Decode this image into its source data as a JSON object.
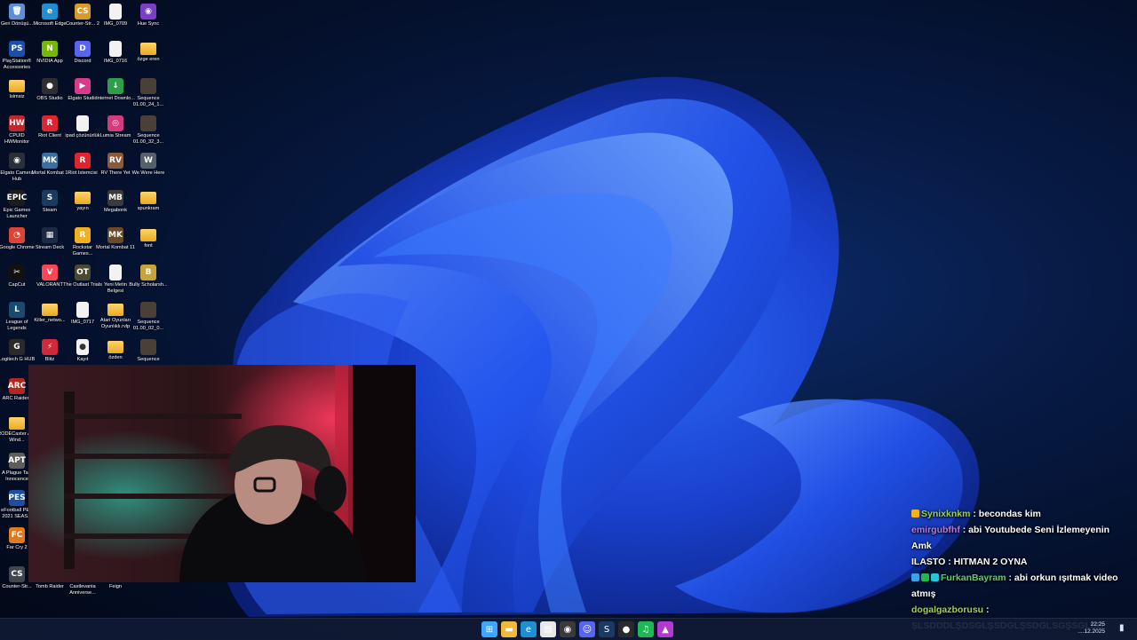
{
  "desktop": {
    "icons": [
      {
        "label": "Geri Dönüşü...",
        "glyph": "🗑",
        "color": "#5c8fd6",
        "type": "app",
        "icon_name": "recycle-bin-icon"
      },
      {
        "label": "Microsoft Edge",
        "glyph": "e",
        "color": "#1f8fd4",
        "type": "app",
        "icon_name": "edge-icon"
      },
      {
        "label": "Counter-Str... 2",
        "glyph": "CS",
        "color": "#d89a2a",
        "type": "app",
        "icon_name": "counter-strike-icon"
      },
      {
        "label": "IMG_0709",
        "glyph": "",
        "color": "#f2f2f2",
        "type": "file",
        "icon_name": "image-file-icon"
      },
      {
        "label": "Hue Sync",
        "glyph": "◉",
        "color": "#7a3fc2",
        "type": "app",
        "icon_name": "hue-sync-icon"
      },
      {
        "label": "PlayStation® Accessories",
        "glyph": "PS",
        "color": "#1b4fa8",
        "type": "app",
        "icon_name": "playstation-icon"
      },
      {
        "label": "NVIDIA App",
        "glyph": "N",
        "color": "#76b900",
        "type": "app",
        "icon_name": "nvidia-icon"
      },
      {
        "label": "Discord",
        "glyph": "D",
        "color": "#5865f2",
        "type": "app",
        "icon_name": "discord-icon"
      },
      {
        "label": "IMG_0716",
        "glyph": "",
        "color": "#f2f2f2",
        "type": "file",
        "icon_name": "image-file-icon"
      },
      {
        "label": "özge eren",
        "glyph": "",
        "color": "#f0b93a",
        "type": "folder",
        "icon_name": "folder-icon"
      },
      {
        "label": "İsimsiz",
        "glyph": "",
        "color": "#f0b93a",
        "type": "folder",
        "icon_name": "folder-icon"
      },
      {
        "label": "OBS Studio",
        "glyph": "●",
        "color": "#302e31",
        "type": "app",
        "icon_name": "obs-icon"
      },
      {
        "label": "Elgato Studio",
        "glyph": "▶",
        "color": "#d93b8c",
        "type": "app",
        "icon_name": "elgato-studio-icon"
      },
      {
        "label": "Internet Downlo...",
        "glyph": "↓",
        "color": "#2f9e4b",
        "type": "app",
        "icon_name": "internet-download-icon"
      },
      {
        "label": "Sequence 01.00_24_1...",
        "glyph": "",
        "color": "#4b4038",
        "type": "app",
        "icon_name": "video-thumb-icon"
      },
      {
        "label": "CPUID HWMonitor",
        "glyph": "HW",
        "color": "#c0282d",
        "type": "app",
        "icon_name": "hwmonitor-icon"
      },
      {
        "label": "Riot Client",
        "glyph": "R",
        "color": "#e0242f",
        "type": "app",
        "icon_name": "riot-client-icon"
      },
      {
        "label": "ipad çözünürlük",
        "glyph": "",
        "color": "#f2f2f2",
        "type": "file",
        "icon_name": "document-icon"
      },
      {
        "label": "Lumia Stream",
        "glyph": "◎",
        "color": "#d53b7c",
        "type": "app",
        "icon_name": "lumia-stream-icon"
      },
      {
        "label": "Sequence 01.00_32_3...",
        "glyph": "",
        "color": "#4b4038",
        "type": "app",
        "icon_name": "video-thumb-icon"
      },
      {
        "label": "Elgato Camera Hub",
        "glyph": "◉",
        "color": "#2b2f3a",
        "type": "app",
        "icon_name": "camera-hub-icon"
      },
      {
        "label": "Mortal Kombat 1",
        "glyph": "MK",
        "color": "#3a6fa3",
        "type": "app",
        "icon_name": "mortal-kombat-icon"
      },
      {
        "label": "Riot İstemcisi",
        "glyph": "R",
        "color": "#e0242f",
        "type": "app",
        "icon_name": "riot-client-icon"
      },
      {
        "label": "RV There Yet",
        "glyph": "RV",
        "color": "#8a5a3a",
        "type": "app",
        "icon_name": "game-icon"
      },
      {
        "label": "We Were Here",
        "glyph": "W",
        "color": "#55606a",
        "type": "app",
        "icon_name": "game-icon"
      },
      {
        "label": "Epic Games Launcher",
        "glyph": "EPIC",
        "color": "#1c1c1c",
        "type": "app",
        "icon_name": "epic-games-icon"
      },
      {
        "label": "Steam",
        "glyph": "S",
        "color": "#1b3a5f",
        "type": "app",
        "icon_name": "steam-icon"
      },
      {
        "label": "yayın",
        "glyph": "",
        "color": "#f0b93a",
        "type": "folder",
        "icon_name": "folder-icon"
      },
      {
        "label": "Megabonk",
        "glyph": "MB",
        "color": "#3b3b3b",
        "type": "app",
        "icon_name": "game-icon"
      },
      {
        "label": "spunkram",
        "glyph": "",
        "color": "#f0b93a",
        "type": "folder",
        "icon_name": "folder-icon"
      },
      {
        "label": "Google Chrome",
        "glyph": "◔",
        "color": "#db4437",
        "type": "app",
        "icon_name": "chrome-icon"
      },
      {
        "label": "Stream Deck",
        "glyph": "▦",
        "color": "#1e2a44",
        "type": "app",
        "icon_name": "stream-deck-icon"
      },
      {
        "label": "Rockstar Games...",
        "glyph": "R",
        "color": "#f2b01e",
        "type": "app",
        "icon_name": "rockstar-icon"
      },
      {
        "label": "Mortal Kombat 11",
        "glyph": "MK",
        "color": "#6b4a2a",
        "type": "app",
        "icon_name": "mortal-kombat-icon"
      },
      {
        "label": "font",
        "glyph": "",
        "color": "#f0b93a",
        "type": "folder",
        "icon_name": "folder-icon"
      },
      {
        "label": "CapCut",
        "glyph": "✂",
        "color": "#111111",
        "type": "app",
        "icon_name": "capcut-icon"
      },
      {
        "label": "VALORANT",
        "glyph": "V",
        "color": "#fd4556",
        "type": "app",
        "icon_name": "valorant-icon"
      },
      {
        "label": "The Outlast Trials",
        "glyph": "OT",
        "color": "#4a4a32",
        "type": "app",
        "icon_name": "game-icon"
      },
      {
        "label": "Yeni Metin Belgesi",
        "glyph": "",
        "color": "#f2f2f2",
        "type": "file",
        "icon_name": "document-icon"
      },
      {
        "label": "Bully Scholarsh...",
        "glyph": "B",
        "color": "#c8a23a",
        "type": "app",
        "icon_name": "game-icon"
      },
      {
        "label": "League of Legends",
        "glyph": "L",
        "color": "#1a4a6e",
        "type": "app",
        "icon_name": "league-icon"
      },
      {
        "label": "Killer_netwo...",
        "glyph": "",
        "color": "#f0b93a",
        "type": "folder",
        "icon_name": "folder-icon"
      },
      {
        "label": "IMG_0717",
        "glyph": "",
        "color": "#f2f2f2",
        "type": "file",
        "icon_name": "image-file-icon"
      },
      {
        "label": "Atari Oyunları Oyunlıklı.rvlp",
        "glyph": "",
        "color": "#f0b93a",
        "type": "folder",
        "icon_name": "folder-icon"
      },
      {
        "label": "Sequence 01.00_02_0...",
        "glyph": "",
        "color": "#4b4038",
        "type": "app",
        "icon_name": "video-thumb-icon"
      },
      {
        "label": "Logitech G HUB",
        "glyph": "G",
        "color": "#2a2a2a",
        "type": "app",
        "icon_name": "logitech-icon"
      },
      {
        "label": "Blitz",
        "glyph": "⚡",
        "color": "#d2283c",
        "type": "app",
        "icon_name": "blitz-icon"
      },
      {
        "label": "Kayıt",
        "glyph": "●",
        "color": "#e8e8e8",
        "type": "file",
        "icon_name": "recording-icon"
      },
      {
        "label": "özden",
        "glyph": "",
        "color": "#f0b93a",
        "type": "folder",
        "icon_name": "folder-icon"
      },
      {
        "label": "Sequence",
        "glyph": "",
        "color": "#4b4038",
        "type": "app",
        "icon_name": "video-thumb-icon"
      },
      {
        "label": "ARC Raiders",
        "glyph": "ARC",
        "color": "#b0281e",
        "type": "app",
        "icon_name": "arc-raiders-icon"
      },
      {
        "label": "RODECaster App Wind...",
        "glyph": "",
        "color": "#f0b93a",
        "type": "folder",
        "icon_name": "folder-icon"
      },
      {
        "label": "A Plague Tale Innocence",
        "glyph": "APT",
        "color": "#5d5d5d",
        "type": "app",
        "icon_name": "game-icon"
      },
      {
        "label": "eFootball PES 2021 SEAS...",
        "glyph": "PES",
        "color": "#1e4fa0",
        "type": "app",
        "icon_name": "efootball-icon"
      },
      {
        "label": "Far Cry 2",
        "glyph": "FC",
        "color": "#e07a1e",
        "type": "app",
        "icon_name": "far-cry-icon"
      },
      {
        "label": "Counter-Str...",
        "glyph": "CS",
        "color": "#41474f",
        "type": "app",
        "icon_name": "counter-strike-icon"
      },
      {
        "label": "Tomb Raider",
        "glyph": "",
        "color": "#2e2a26",
        "type": "app",
        "icon_name": "tomb-raider-icon"
      },
      {
        "label": "Castlevania Anniverse...",
        "glyph": "",
        "color": "#2e2a26",
        "type": "app",
        "icon_name": "castlevania-icon"
      },
      {
        "label": "Feign",
        "glyph": "",
        "color": "#2e2a26",
        "type": "app",
        "icon_name": "feign-icon"
      }
    ]
  },
  "chat": {
    "messages": [
      {
        "user": "Synixknkm",
        "text": "becondas kim",
        "color": "#9ad34a",
        "badges": [
          "#f5b21a"
        ]
      },
      {
        "user": "emirgubfhf",
        "text": "abi Youtubede Seni İzlemeyenin Amk",
        "color": "#b877e3",
        "badges": []
      },
      {
        "user": "ILASTO",
        "text": "HITMAN 2 OYNA",
        "color": "#ffffff",
        "badges": []
      },
      {
        "user": "FurkanBayram",
        "text": "abi orkun ışıtmak video atmış",
        "color": "#56d26b",
        "badges": [
          "#3aa0e8",
          "#23b84f",
          "#26c6da"
        ]
      },
      {
        "user": "dogalgazborusu",
        "text": "ŞLSDDDLŞDSGLŞSDGLŞSDGLSGŞSGLŞD",
        "color": "#9ad34a",
        "badges": []
      }
    ]
  },
  "taskbar": {
    "apps": [
      {
        "name": "start-button",
        "glyph": "⊞",
        "color": "#3ea6ff"
      },
      {
        "name": "file-explorer-icon",
        "glyph": "▬",
        "color": "#f0b93a"
      },
      {
        "name": "edge-taskbar-icon",
        "glyph": "e",
        "color": "#1f8fd4"
      },
      {
        "name": "notepad-taskbar-icon",
        "glyph": "▤",
        "color": "#e8e8e8"
      },
      {
        "name": "obs-taskbar-icon",
        "glyph": "◉",
        "color": "#3a3a3a"
      },
      {
        "name": "discord-taskbar-icon",
        "glyph": "☺",
        "color": "#5865f2"
      },
      {
        "name": "steam-taskbar-icon",
        "glyph": "S",
        "color": "#1b3a5f"
      },
      {
        "name": "obs-studio-taskbar-icon",
        "glyph": "●",
        "color": "#2a2a2a"
      },
      {
        "name": "spotify-taskbar-icon",
        "glyph": "♫",
        "color": "#1db954"
      },
      {
        "name": "stream-tool-taskbar-icon",
        "glyph": "▲",
        "color": "#b23ad1"
      }
    ],
    "clock_time": "22:25",
    "clock_date": "....12.2025"
  }
}
